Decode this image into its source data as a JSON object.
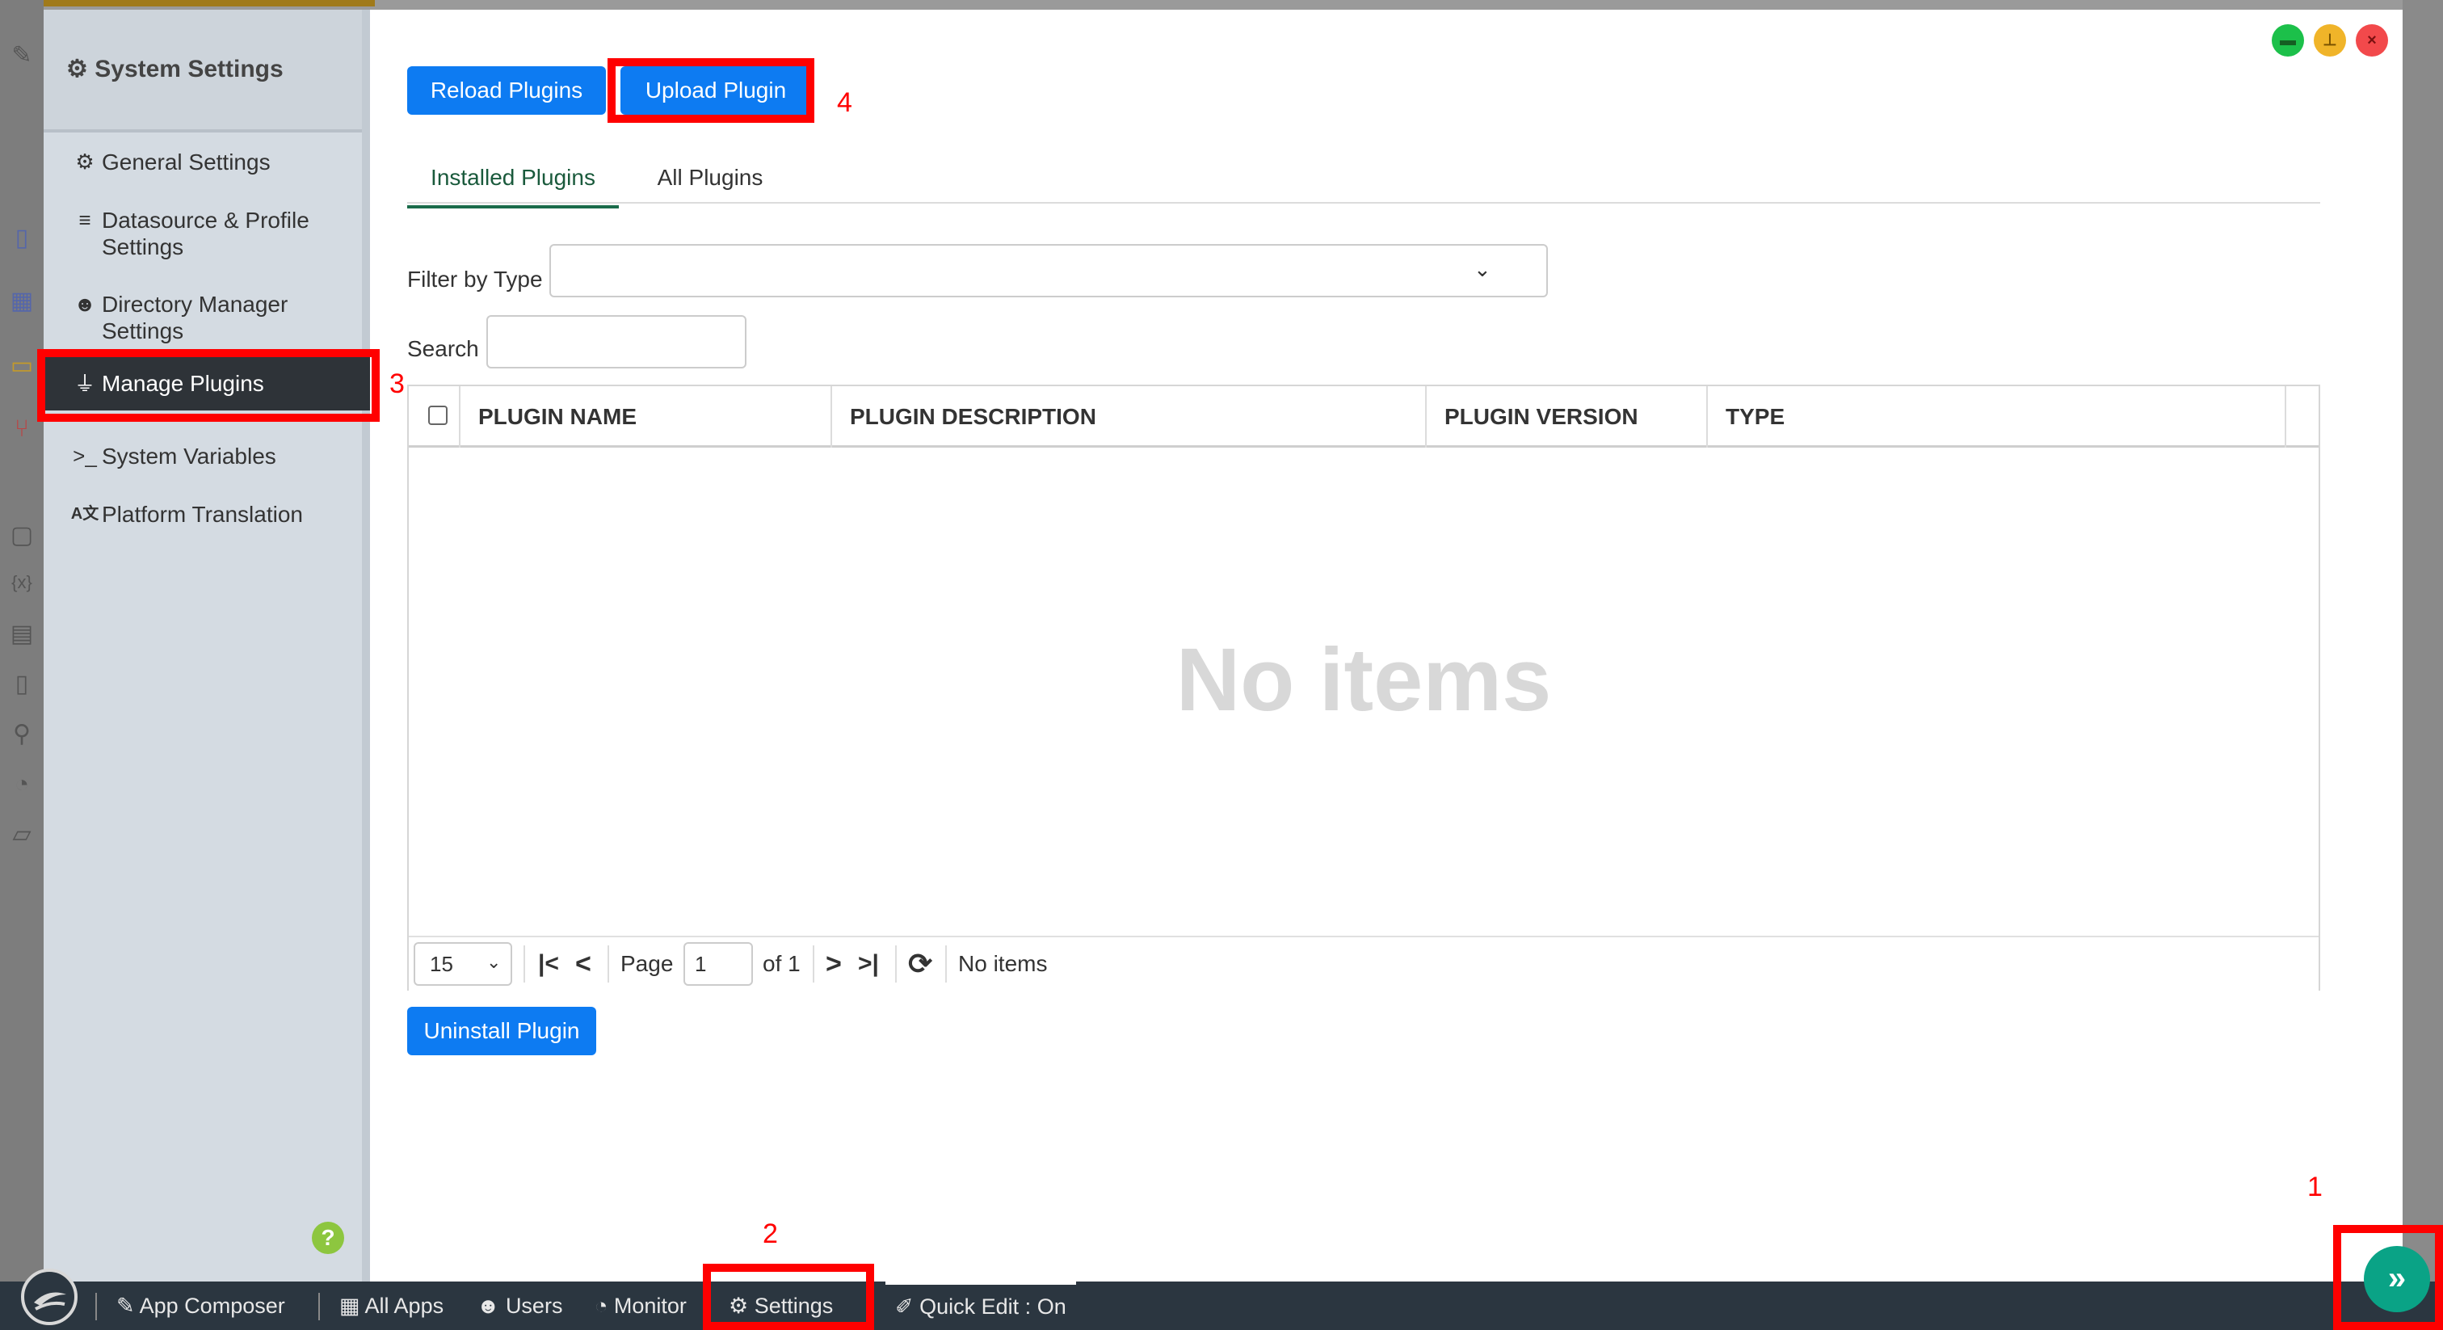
{
  "sidebar": {
    "title": "System Settings",
    "items": [
      {
        "label": "General Settings"
      },
      {
        "label": "Datasource & Profile Settings"
      },
      {
        "label": "Directory Manager Settings"
      },
      {
        "label": "Manage Plugins"
      },
      {
        "label": "System Variables"
      },
      {
        "label": "Platform Translation"
      }
    ],
    "help": "?"
  },
  "toolbar": {
    "reload_label": "Reload Plugins",
    "upload_label": "Upload Plugin"
  },
  "tabs": [
    {
      "label": "Installed Plugins"
    },
    {
      "label": "All Plugins"
    }
  ],
  "filter": {
    "label": "Filter by Type",
    "value": ""
  },
  "search": {
    "label": "Search",
    "value": ""
  },
  "table": {
    "columns": [
      "PLUGIN NAME",
      "PLUGIN DESCRIPTION",
      "PLUGIN VERSION",
      "TYPE"
    ],
    "empty_text": "No items"
  },
  "pager": {
    "page_size": "15",
    "page_label": "Page",
    "page_value": "1",
    "of_label": "of 1",
    "status": "No items"
  },
  "actions": {
    "uninstall_label": "Uninstall Plugin"
  },
  "taskbar": {
    "items": [
      {
        "label": "App Composer"
      },
      {
        "label": "All Apps"
      },
      {
        "label": "Users"
      },
      {
        "label": "Monitor"
      },
      {
        "label": "Settings"
      },
      {
        "label": "Quick Edit : On"
      }
    ]
  },
  "annotations": [
    "1",
    "2",
    "3",
    "4"
  ],
  "colors": {
    "primary": "#0d7bf2",
    "annotation": "#ff0000",
    "active_nav": "#2e3338",
    "fab": "#0aa386"
  }
}
